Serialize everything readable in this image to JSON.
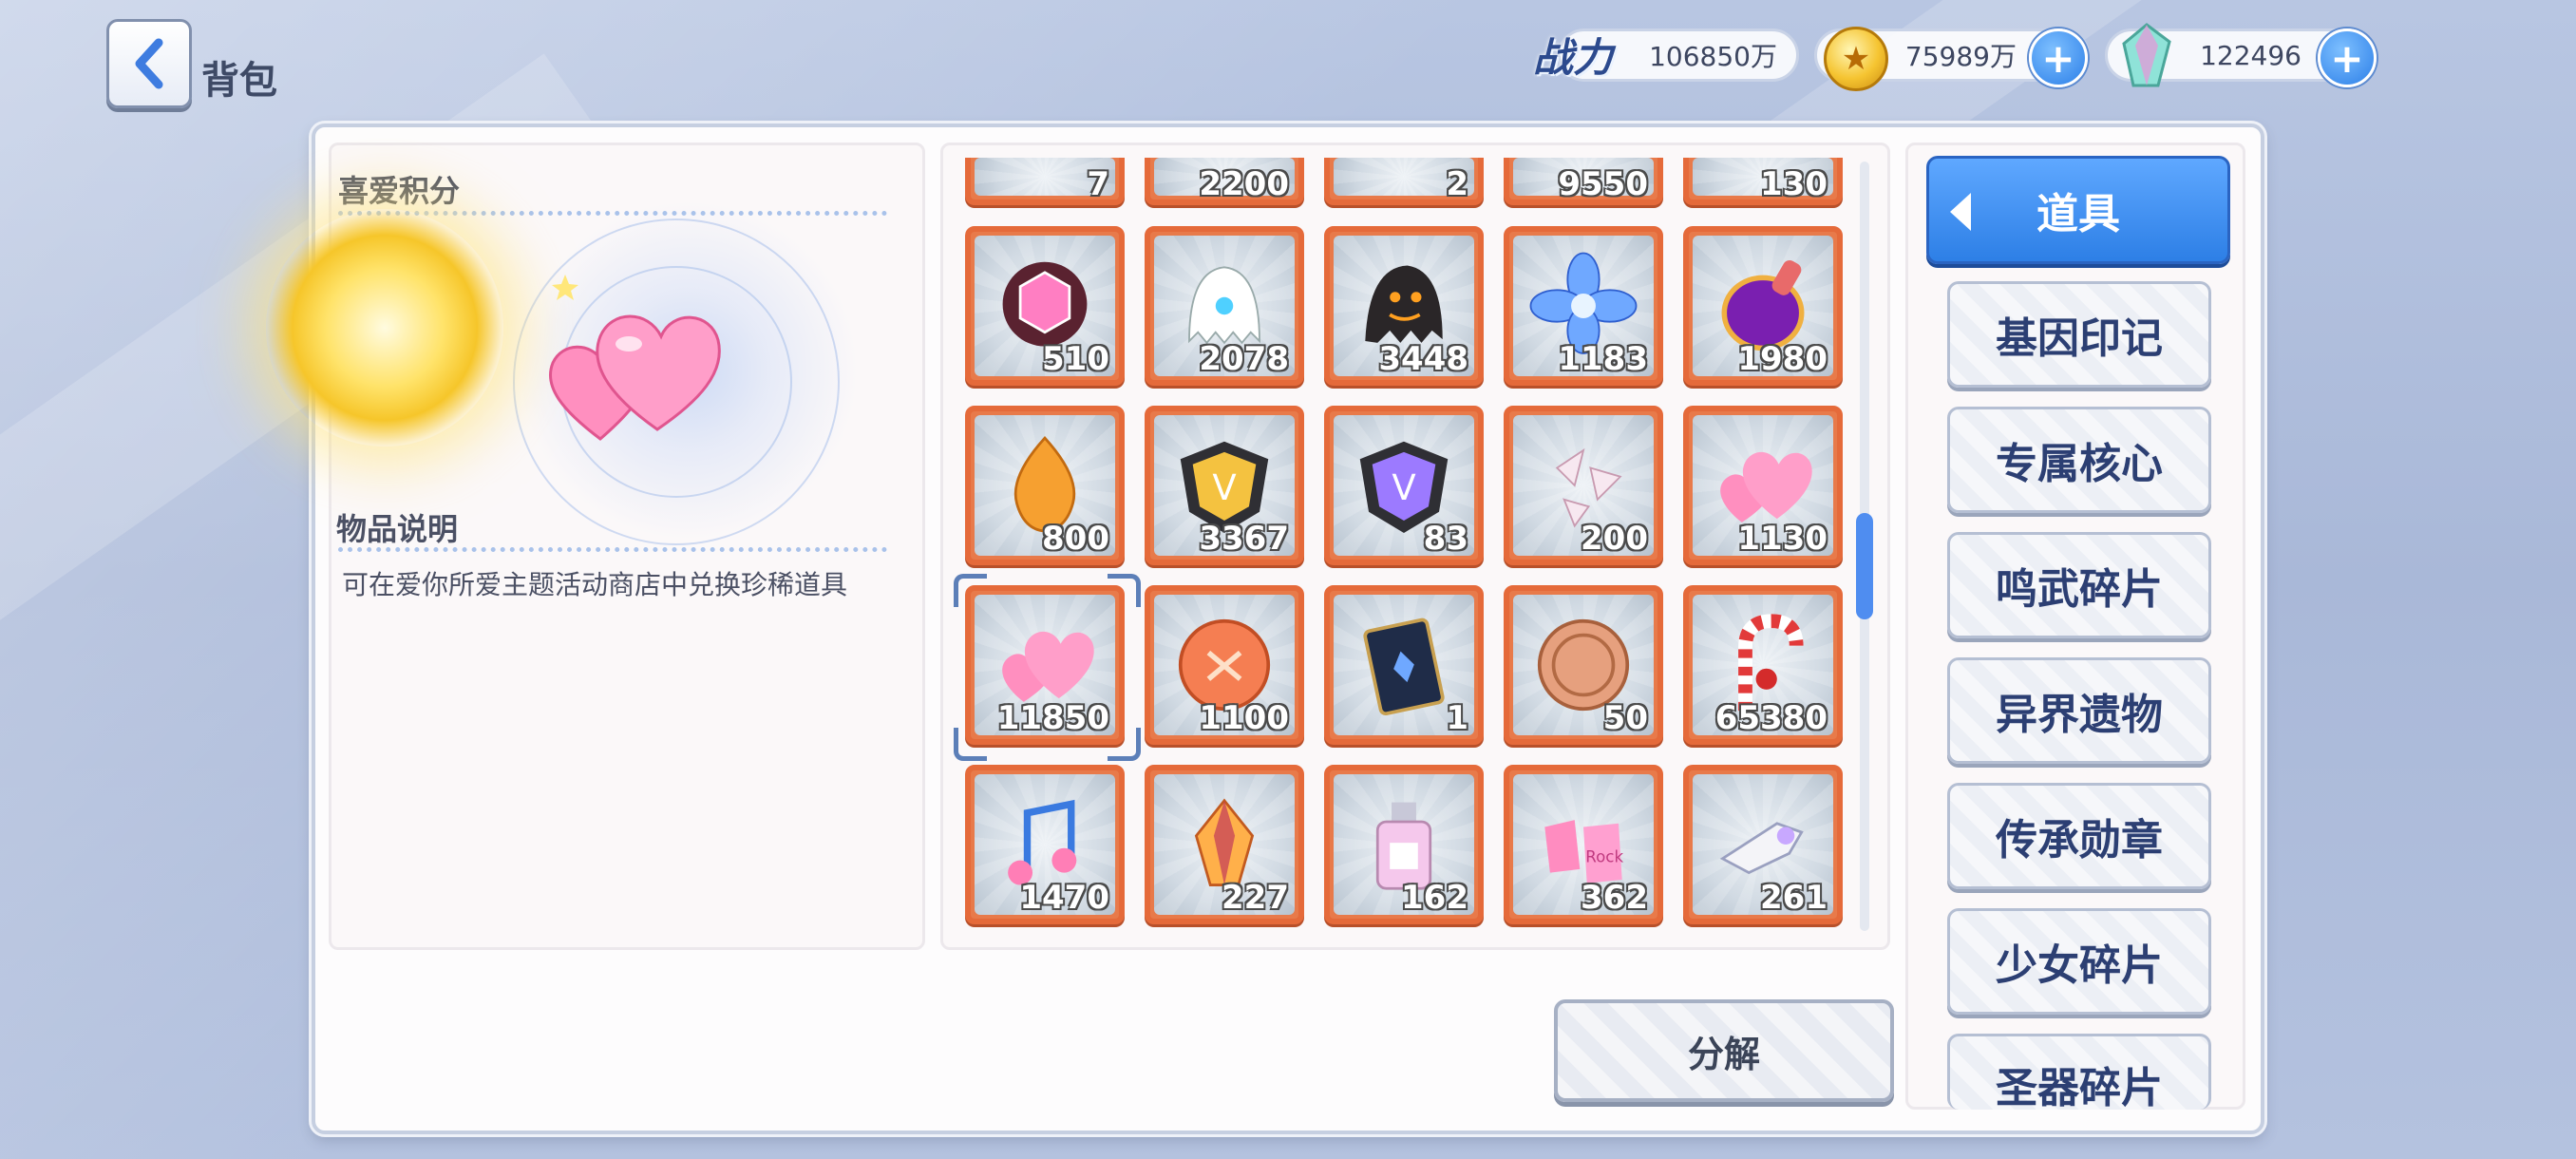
{
  "header": {
    "title": "背包",
    "back_icon": "chevron-left-icon"
  },
  "resources": {
    "power_label": "战力",
    "power_value": "106850万",
    "gold_value": "75989万",
    "gem_value": "122496"
  },
  "detail": {
    "section_title": "喜爱积分",
    "desc_title": "物品说明",
    "desc_text": "可在爱你所爱主题活动商店中兑换珍稀道具"
  },
  "grid": {
    "partial_row_counts": [
      "7",
      "2200",
      "2",
      "9550",
      "130"
    ],
    "items": [
      {
        "name": "pink-gem-badge",
        "count": "510"
      },
      {
        "name": "white-ghost",
        "count": "2078"
      },
      {
        "name": "black-ghost",
        "count": "3448"
      },
      {
        "name": "blue-flower",
        "count": "1183"
      },
      {
        "name": "purple-stamp",
        "count": "1980"
      },
      {
        "name": "orange-drop",
        "count": "800"
      },
      {
        "name": "gold-v-badge",
        "count": "3367"
      },
      {
        "name": "purple-v-badge",
        "count": "83"
      },
      {
        "name": "crystal-shards",
        "count": "200"
      },
      {
        "name": "pink-hearts",
        "count": "1130"
      },
      {
        "name": "pink-hearts-selected",
        "count": "11850"
      },
      {
        "name": "orange-coin",
        "count": "1100"
      },
      {
        "name": "dark-book",
        "count": "1"
      },
      {
        "name": "bronze-coin",
        "count": "50"
      },
      {
        "name": "candy-cane",
        "count": "65380"
      },
      {
        "name": "music-note",
        "count": "1470"
      },
      {
        "name": "fire-crystal",
        "count": "227"
      },
      {
        "name": "perfume-bottle",
        "count": "162"
      },
      {
        "name": "rock-gloves",
        "count": "362"
      },
      {
        "name": "pearl-gun",
        "count": "261"
      }
    ]
  },
  "decompose_label": "分解",
  "categories": {
    "active": "道具",
    "items": [
      "基因印记",
      "专属核心",
      "鸣武碎片",
      "异界遗物",
      "传承勋章",
      "少女碎片",
      "圣器碎片"
    ]
  },
  "colors": {
    "accent": "#2d7fe6",
    "slot_border": "#e56a3a",
    "category_text": "#2c3f73"
  }
}
